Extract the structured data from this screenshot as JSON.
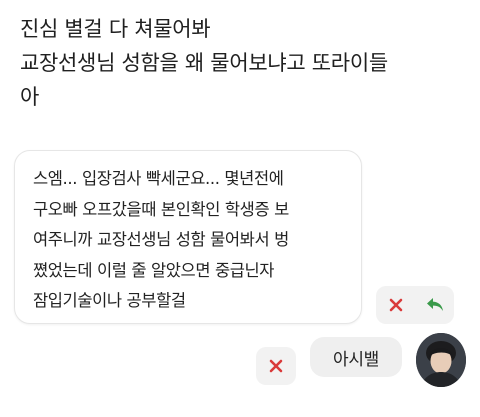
{
  "post": {
    "lines": [
      "진심 별걸 다 쳐물어봐",
      "교장선생님 성함을 왜 물어보냐고 또라이들",
      "아"
    ]
  },
  "comment": {
    "lines": [
      "스엠... 입장검사 빡세군요... 몇년전에",
      "구오빠 오프갔을때 본인확인 학생증 보",
      "여주니까 교장선생님 성함 물어봐서 벙",
      "쪘었는데 이럴 줄 알았으면 중급닌자",
      "잠입기술이나 공부할걸"
    ]
  },
  "actions": {
    "dismiss_icon": "close-icon",
    "reply_icon": "reply-arrow-icon",
    "dismiss_color": "#d93a3a",
    "reply_color": "#3a9a4a"
  },
  "reply": {
    "text": "아시밸"
  },
  "avatar": {
    "icon": "user-avatar"
  }
}
